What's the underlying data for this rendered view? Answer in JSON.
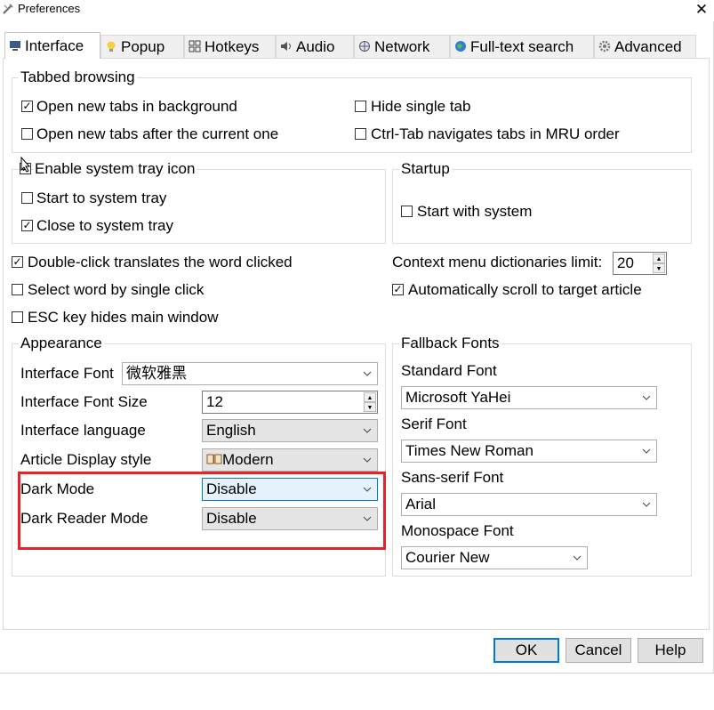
{
  "window": {
    "title": "Preferences",
    "close_glyph": "✕"
  },
  "tabs": [
    {
      "label": "Interface",
      "icon": "monitor-icon"
    },
    {
      "label": "Popup",
      "icon": "lightbulb-icon"
    },
    {
      "label": "Hotkeys",
      "icon": "keyboard-icon"
    },
    {
      "label": "Audio",
      "icon": "speaker-icon"
    },
    {
      "label": "Network",
      "icon": "network-icon"
    },
    {
      "label": "Full-text search",
      "icon": "globe-icon"
    },
    {
      "label": "Advanced",
      "icon": "gear-icon"
    }
  ],
  "tabbed_browsing": {
    "title": "Tabbed browsing",
    "open_bg": {
      "label": "Open new tabs in background",
      "checked": true
    },
    "open_after": {
      "label": "Open new tabs after the current one",
      "checked": false
    },
    "hide_single": {
      "label": "Hide single tab",
      "checked": false
    },
    "ctrl_tab": {
      "label": "Ctrl-Tab navigates tabs in MRU order",
      "checked": false
    }
  },
  "tray": {
    "title": "Enable system tray icon",
    "enabled": true,
    "start_tray": {
      "label": "Start to system tray",
      "checked": false
    },
    "close_tray": {
      "label": "Close to system tray",
      "checked": true
    }
  },
  "startup": {
    "title": "Startup",
    "start_system": {
      "label": "Start with system",
      "checked": false
    }
  },
  "misc": {
    "double_click": {
      "label": "Double-click translates the word clicked",
      "checked": true
    },
    "single_click": {
      "label": "Select word by single click",
      "checked": false
    },
    "esc_hides": {
      "label": "ESC key hides main window",
      "checked": false
    },
    "ctx_limit_label": "Context menu dictionaries limit:",
    "ctx_limit_value": "20",
    "auto_scroll": {
      "label": "Automatically scroll to target article",
      "checked": true
    }
  },
  "appearance": {
    "title": "Appearance",
    "font_label": "Interface Font",
    "font_value": "微软雅黑",
    "font_size_label": "Interface Font Size",
    "font_size_value": "12",
    "language_label": "Interface language",
    "language_value": "English",
    "article_label": "Article Display style",
    "article_value": "Modern",
    "dark_label": "Dark Mode",
    "dark_value": "Disable",
    "dark_reader_label": "Dark Reader Mode",
    "dark_reader_value": "Disable"
  },
  "fallback": {
    "title": "Fallback Fonts",
    "standard_label": "Standard Font",
    "standard_value": "Microsoft YaHei",
    "serif_label": "Serif Font",
    "serif_value": "Times New Roman",
    "sans_label": "Sans-serif Font",
    "sans_value": "Arial",
    "mono_label": "Monospace Font",
    "mono_value": "Courier New"
  },
  "buttons": {
    "ok": "OK",
    "cancel": "Cancel",
    "help": "Help"
  },
  "colors": {
    "highlight": "#e8222a",
    "focus": "#0078d7"
  }
}
